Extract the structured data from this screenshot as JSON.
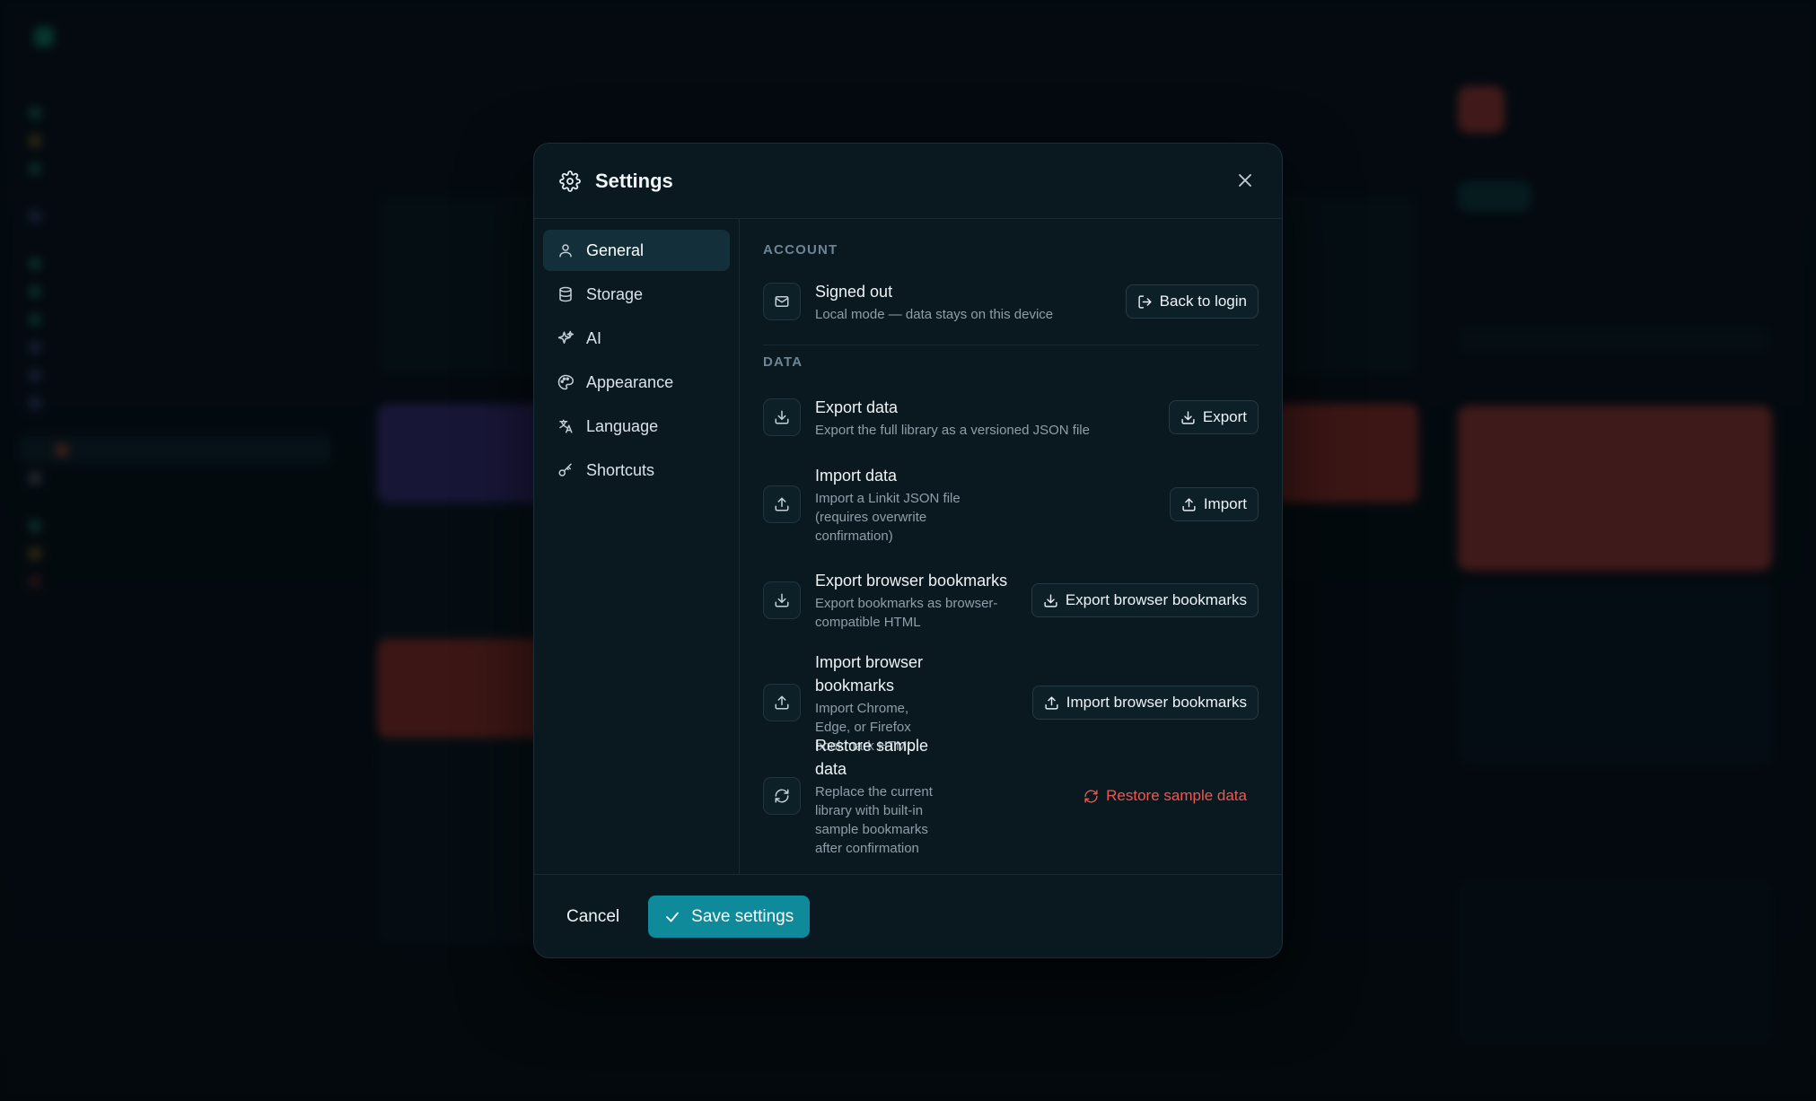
{
  "modal": {
    "title": "Settings",
    "nav": [
      {
        "label": "General",
        "icon": "user-icon",
        "active": true
      },
      {
        "label": "Storage",
        "icon": "database-icon"
      },
      {
        "label": "AI",
        "icon": "sparkles-icon"
      },
      {
        "label": "Appearance",
        "icon": "palette-icon"
      },
      {
        "label": "Language",
        "icon": "translate-icon"
      },
      {
        "label": "Shortcuts",
        "icon": "key-icon"
      }
    ],
    "account": {
      "section_label": "ACCOUNT",
      "status_title": "Signed out",
      "status_desc": "Local mode — data stays on this device",
      "button": "Back to login"
    },
    "data": {
      "section_label": "DATA",
      "rows": [
        {
          "title": "Export data",
          "desc": "Export the full library as a versioned JSON file",
          "button": "Export",
          "icon": "download-icon"
        },
        {
          "title": "Import data",
          "desc": "Import a Linkit JSON file (requires overwrite confirmation)",
          "button": "Import",
          "icon": "upload-icon"
        },
        {
          "title": "Export browser bookmarks",
          "desc": "Export bookmarks as browser-compatible HTML",
          "button": "Export browser bookmarks",
          "icon": "download-icon"
        },
        {
          "title": "Import browser bookmarks",
          "desc": "Import Chrome, Edge, or Firefox bookmark HTML",
          "button": "Import browser bookmarks",
          "icon": "upload-icon"
        },
        {
          "title": "Restore sample data",
          "desc": "Replace the current library with built-in sample bookmarks after confirmation",
          "button": "Restore sample data",
          "icon": "refresh-icon"
        }
      ]
    },
    "footer": {
      "cancel": "Cancel",
      "save": "Save settings"
    }
  },
  "colors": {
    "accent": "#0f8a9b",
    "danger": "#f0564f",
    "modal_bg": "#0a1920"
  }
}
